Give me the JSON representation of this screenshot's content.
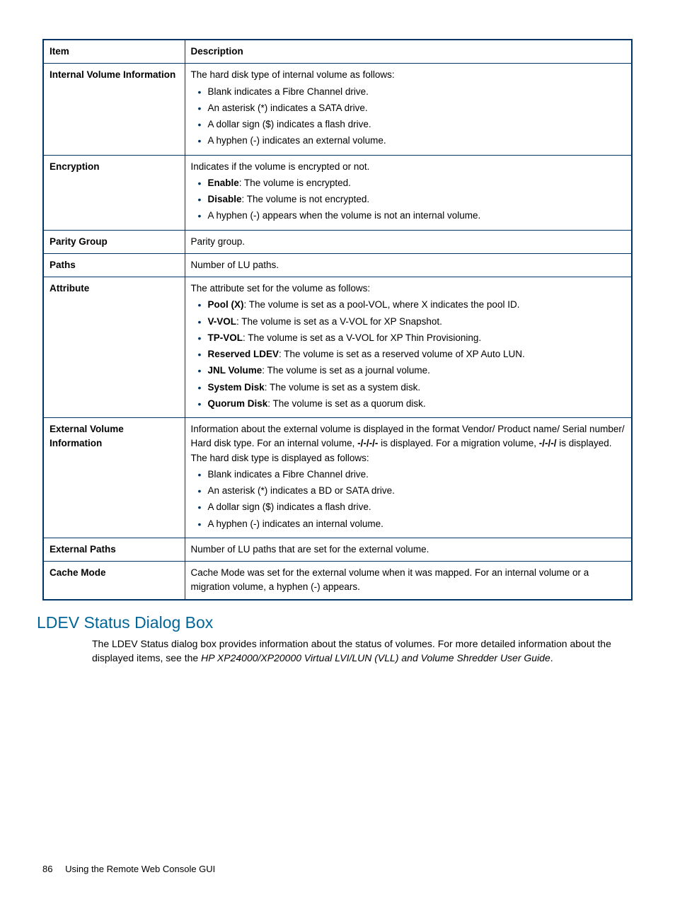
{
  "table": {
    "headers": {
      "item": "Item",
      "description": "Description"
    },
    "rows": [
      {
        "item": "Internal Volume Information",
        "intro": "The hard disk type of internal volume as follows:",
        "bullets": [
          {
            "label": "",
            "text": "Blank indicates a Fibre Channel drive."
          },
          {
            "label": "",
            "text": "An asterisk (*) indicates a SATA drive."
          },
          {
            "label": "",
            "text": "A dollar sign ($) indicates a flash drive."
          },
          {
            "label": "",
            "text": "A hyphen (-) indicates an external volume."
          }
        ]
      },
      {
        "item": "Encryption",
        "intro": "Indicates if the volume is encrypted or not.",
        "bullets": [
          {
            "label": "Enable",
            "text": ": The volume is encrypted."
          },
          {
            "label": "Disable",
            "text": ": The volume is not encrypted."
          },
          {
            "label": "",
            "text": "A hyphen (-) appears when the volume is not an internal volume."
          }
        ]
      },
      {
        "item": "Parity Group",
        "intro": "Parity group.",
        "bullets": []
      },
      {
        "item": "Paths",
        "intro": "Number of LU paths.",
        "bullets": []
      },
      {
        "item": "Attribute",
        "intro": "The attribute set for the volume as follows:",
        "bullets": [
          {
            "label": "Pool (X)",
            "text": ": The volume is set as a pool-VOL, where X indicates the pool ID."
          },
          {
            "label": "V-VOL",
            "text": ": The volume is set as a V-VOL for XP Snapshot."
          },
          {
            "label": "TP-VOL",
            "text": ": The volume is set as a V-VOL for XP Thin Provisioning."
          },
          {
            "label": "Reserved LDEV",
            "text": ": The volume is set as a reserved volume of XP Auto LUN."
          },
          {
            "label": "JNL Volume",
            "text": ": The volume is set as a journal volume."
          },
          {
            "label": "System Disk",
            "text": ": The volume is set as a system disk."
          },
          {
            "label": "Quorum Disk",
            "text": ": The volume is set as a quorum disk."
          }
        ]
      },
      {
        "item": "External Volume Information",
        "intro_segments": [
          {
            "t": "Information about the external volume is displayed in the format Vendor/ Product name/ Serial number/ Hard disk type. For an internal volume, ",
            "b": false
          },
          {
            "t": "-/-/-/-",
            "b": true
          },
          {
            "t": " is displayed. For a migration volume, ",
            "b": false
          },
          {
            "t": "-/-/-/",
            "b": true
          },
          {
            "t": "  is displayed. The hard disk type is displayed as follows:",
            "b": false
          }
        ],
        "bullets": [
          {
            "label": "",
            "text": "Blank indicates a Fibre Channel drive."
          },
          {
            "label": "",
            "text": "An asterisk (*) indicates a BD or SATA drive."
          },
          {
            "label": "",
            "text": "A dollar sign ($) indicates a flash drive."
          },
          {
            "label": "",
            "text": "A hyphen (-) indicates an internal volume."
          }
        ]
      },
      {
        "item": "External Paths",
        "intro": "Number of LU paths that are set for the external volume.",
        "bullets": []
      },
      {
        "item": "Cache Mode",
        "intro": "Cache Mode was set for the external volume when it was mapped. For an internal volume or a migration volume, a hyphen (-) appears.",
        "bullets": []
      }
    ]
  },
  "section": {
    "heading": "LDEV Status Dialog Box",
    "text_lead": "The LDEV Status dialog box provides information about the status of volumes. For more detailed information about the displayed items, see the ",
    "text_italic": "HP XP24000/XP20000 Virtual LVI/LUN (VLL) and Volume Shredder User Guide",
    "text_trail": "."
  },
  "footer": {
    "page": "86",
    "title": "Using the Remote Web Console GUI"
  }
}
